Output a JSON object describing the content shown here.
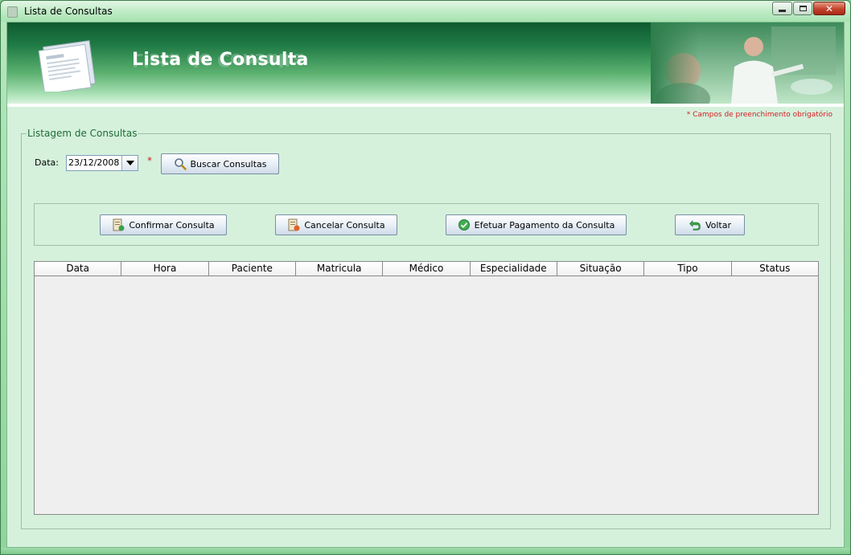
{
  "window": {
    "title": "Lista de Consultas",
    "controls": {
      "minimize": "minimize",
      "maximize": "maximize",
      "close": "✕"
    }
  },
  "banner": {
    "title": "Lista de Consulta"
  },
  "required_note": "* Campos de preenchimento obrigatório",
  "listing": {
    "legend": "Listagem de Consultas",
    "date_label": "Data:",
    "date_value": "23/12/2008",
    "required_mark": "*",
    "search_button": "Buscar Consultas"
  },
  "actions": {
    "confirm": "Confirmar Consulta",
    "cancel": "Cancelar Consulta",
    "pay": "Efetuar Pagamento da Consulta",
    "back": "Voltar"
  },
  "table": {
    "columns": [
      "Data",
      "Hora",
      "Paciente",
      "Matricula",
      "Médico",
      "Especialidade",
      "Situação",
      "Tipo",
      "Status"
    ],
    "rows": []
  },
  "colors": {
    "accent_green": "#1e6b35",
    "required_red": "#d42020",
    "banner_dark": "#0f5a30"
  },
  "icons": [
    "app-icon",
    "document-icon",
    "search-icon",
    "confirm-icon",
    "cancel-icon",
    "check-circle-icon",
    "back-arrow-icon"
  ]
}
